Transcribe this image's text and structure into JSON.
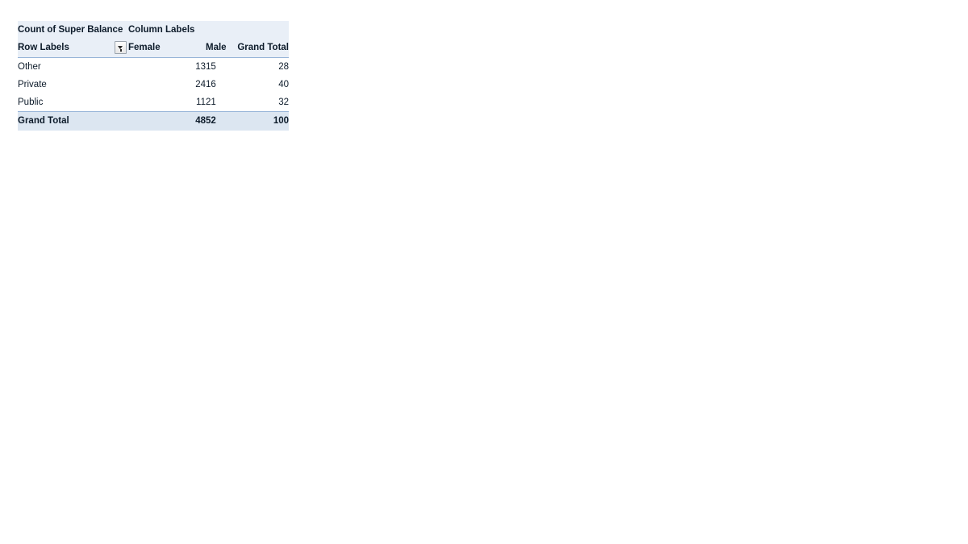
{
  "pivot": {
    "value_field_label": "Count of Super Balance",
    "column_labels_header": "Column Labels",
    "row_labels_header": "Row Labels",
    "column_headers": [
      "Female",
      "Male",
      "Grand Total"
    ],
    "rows": [
      {
        "label": "Other",
        "female": "13",
        "male": "15",
        "grand_total": "28"
      },
      {
        "label": "Private",
        "female": "24",
        "male": "16",
        "grand_total": "40"
      },
      {
        "label": "Public",
        "female": "11",
        "male": "21",
        "grand_total": "32"
      }
    ],
    "total_row": {
      "label": "Grand Total",
      "female": "48",
      "male": "52",
      "grand_total": "100"
    },
    "icons": {
      "column_labels_filter": "filter-dropdown-icon",
      "row_labels_filter": "filter-dropdown-icon"
    },
    "colors": {
      "header_background": "#e9eff7",
      "total_row_background": "#dce6f1",
      "divider": "#95b3d7",
      "text": "#0d1b2a",
      "page_background": "#ffffff"
    }
  }
}
